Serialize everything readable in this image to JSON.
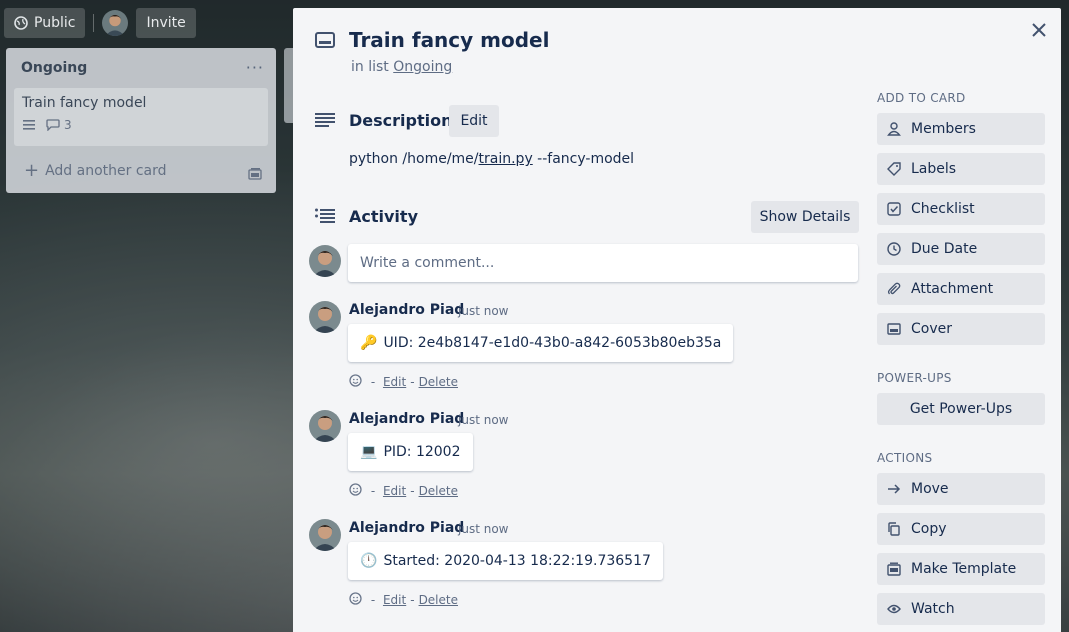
{
  "board_bar": {
    "visibility_label": "Public",
    "invite_label": "Invite"
  },
  "list": {
    "title": "Ongoing",
    "menu_glyph": "···",
    "card": {
      "title": "Train fancy model",
      "comment_count": "3"
    },
    "add_card_label": "Add another card"
  },
  "card": {
    "title": "Train fancy model",
    "in_list_prefix": "in list",
    "list_name": "Ongoing",
    "description": {
      "heading": "Description",
      "edit_label": "Edit",
      "text_before": "python /home/me/",
      "text_link": "train.py",
      "text_after": " --fancy-model"
    },
    "activity": {
      "heading": "Activity",
      "show_details_label": "Show Details",
      "comment_placeholder": "Write a comment...",
      "comments": [
        {
          "author": "Alejandro Piad",
          "time": "just now",
          "emoji": "🔑",
          "text": "UID: 2e4b8147-e1d0-43b0-a842-6053b80eb35a",
          "edit": "Edit",
          "delete": "Delete"
        },
        {
          "author": "Alejandro Piad",
          "time": "just now",
          "emoji": "💻",
          "text": "PID: 12002",
          "edit": "Edit",
          "delete": "Delete"
        },
        {
          "author": "Alejandro Piad",
          "time": "just now",
          "emoji": "🕛",
          "text": "Started: 2020-04-13 18:22:19.736517",
          "edit": "Edit",
          "delete": "Delete"
        }
      ]
    }
  },
  "sidebar": {
    "add_to_card_heading": "ADD TO CARD",
    "add_to_card": [
      {
        "label": "Members",
        "icon": "person-icon"
      },
      {
        "label": "Labels",
        "icon": "tag-icon"
      },
      {
        "label": "Checklist",
        "icon": "checkbox-icon"
      },
      {
        "label": "Due Date",
        "icon": "clock-icon"
      },
      {
        "label": "Attachment",
        "icon": "paperclip-icon"
      },
      {
        "label": "Cover",
        "icon": "cover-icon"
      }
    ],
    "power_ups_heading": "POWER-UPS",
    "get_power_ups_label": "Get Power-Ups",
    "actions_heading": "ACTIONS",
    "actions": [
      {
        "label": "Move",
        "icon": "arrow-right-icon"
      },
      {
        "label": "Copy",
        "icon": "copy-icon"
      },
      {
        "label": "Make Template",
        "icon": "template-icon"
      },
      {
        "label": "Watch",
        "icon": "eye-icon"
      }
    ]
  },
  "colors": {
    "modal_bg": "#f4f5f7",
    "button_bg": "#e4e6ea",
    "text_primary": "#172b4d",
    "text_secondary": "#5e6c84"
  }
}
